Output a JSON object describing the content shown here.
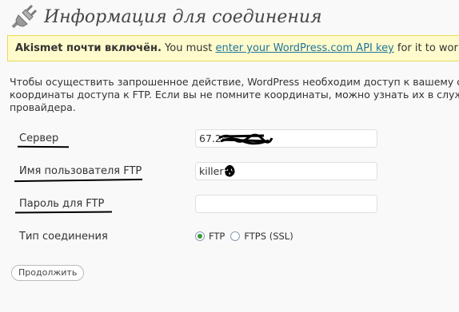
{
  "header": {
    "title": "Информация для соединения",
    "icon": "plug-icon"
  },
  "notice": {
    "plugin_name": "Akismet почти включён.",
    "text_before": " You must ",
    "link_text": "enter your WordPress.com API key",
    "text_after": " for it to work."
  },
  "intro": {
    "line1": "Чтобы осуществить запрошенное действие, WordPress необходим доступ к вашему се",
    "line2": "координаты доступа к FTP. Если вы не помните координаты, можно узнать их в служб",
    "line3": "провайдера."
  },
  "form": {
    "server": {
      "label": "Сервер",
      "value": "67.2"
    },
    "username": {
      "label": "Имя пользователя FTP",
      "value": "killer"
    },
    "password": {
      "label": "Пароль для FTP",
      "value": ""
    },
    "connection_type": {
      "label": "Тип соединения",
      "options": [
        {
          "label": "FTP",
          "selected": true
        },
        {
          "label": "FTPS (SSL)",
          "selected": false
        }
      ]
    },
    "submit_label": "Продолжить"
  },
  "colors": {
    "notice_bg": "#fffbcc",
    "notice_border": "#e6db55",
    "link": "#21759b",
    "title": "#464646",
    "radio_selected": "#3a9a3a"
  }
}
